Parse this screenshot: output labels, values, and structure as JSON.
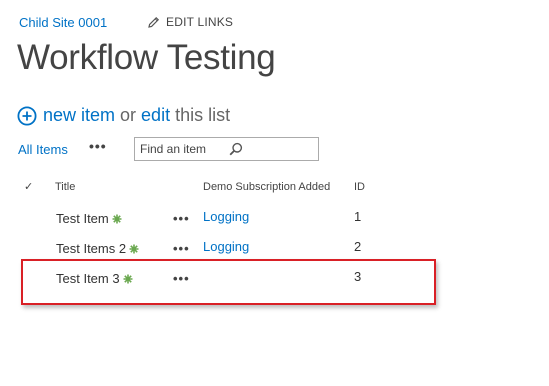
{
  "header": {
    "breadcrumb": "Child Site 0001",
    "edit_links": "EDIT LINKS",
    "title": "Workflow Testing"
  },
  "list_actions": {
    "new_item": "new item",
    "or": "or",
    "edit": "edit",
    "this_list": "this list"
  },
  "views": {
    "current": "All Items",
    "more": "•••"
  },
  "search": {
    "placeholder": "Find an item"
  },
  "columns": {
    "check": "✓",
    "title": "Title",
    "demo": "Demo Subscription Added",
    "id": "ID"
  },
  "rows": [
    {
      "title": "Test Item",
      "menu": "•••",
      "demo": "Logging",
      "id": "1"
    },
    {
      "title": "Test Items 2",
      "menu": "•••",
      "demo": "Logging",
      "id": "2"
    },
    {
      "title": "Test Item 3",
      "menu": "•••",
      "demo": "",
      "id": "3"
    }
  ],
  "colors": {
    "link": "#0072c6",
    "new_badge": "#6aa84f",
    "highlight": "#d92026"
  }
}
